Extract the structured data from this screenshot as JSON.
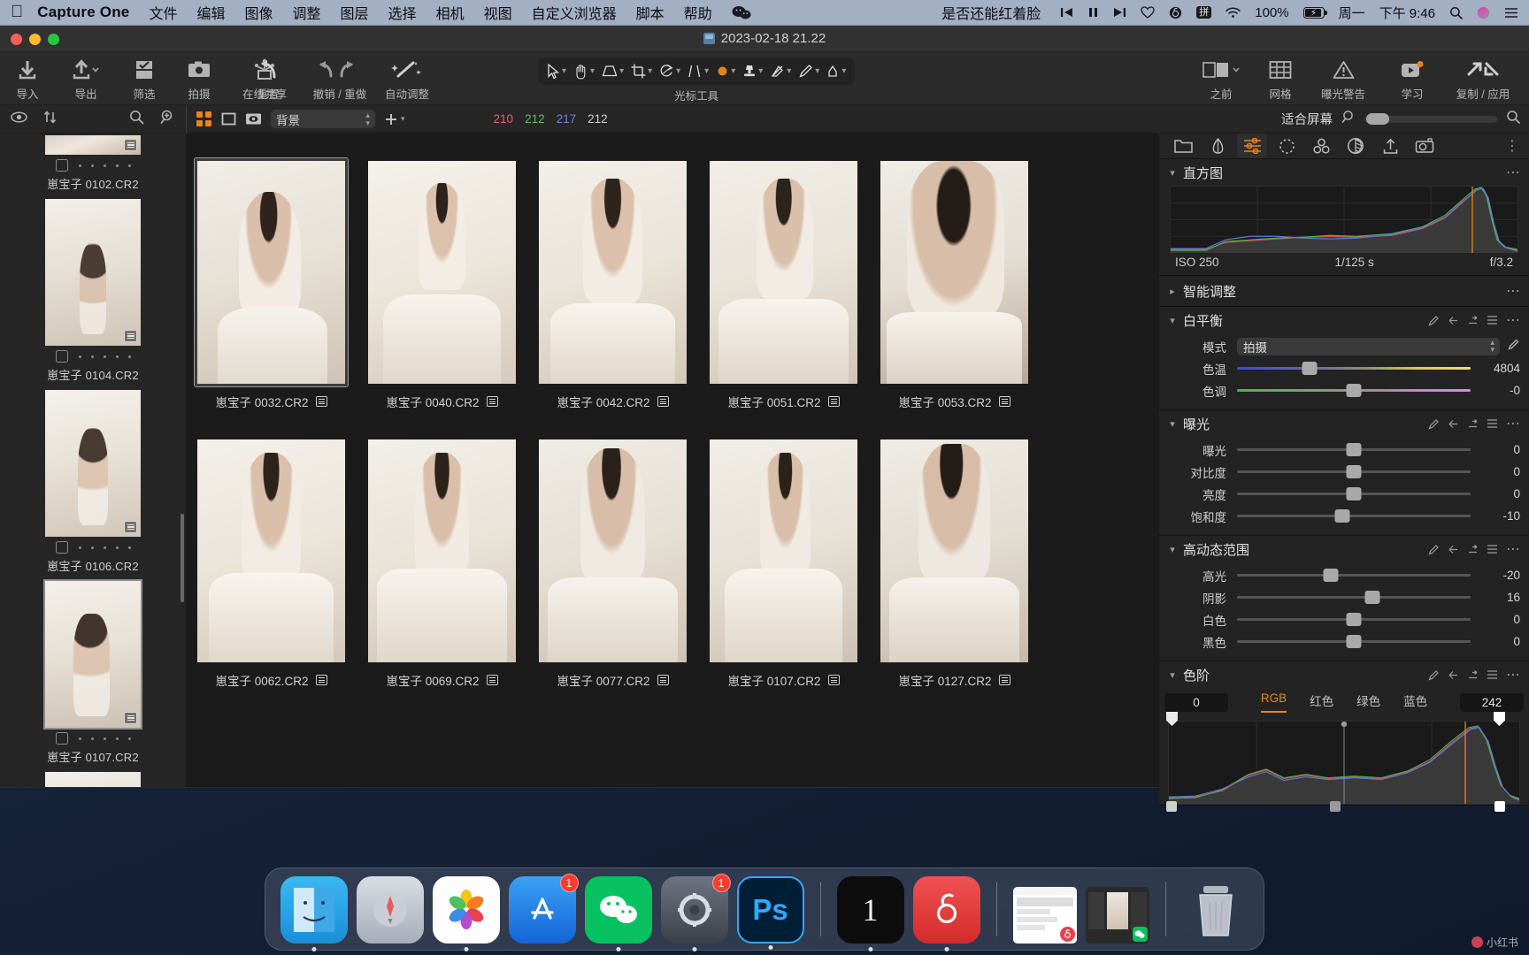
{
  "menubar": {
    "apple_icon": "apple-icon",
    "app_name": "Capture One",
    "items": [
      "文件",
      "编辑",
      "图像",
      "调整",
      "图层",
      "选择",
      "相机",
      "视图",
      "自定义浏览器",
      "脚本",
      "帮助"
    ],
    "wechat_icon": "wechat-icon",
    "now_playing": "是否还能红着脸",
    "controls": [
      "prev-track-icon",
      "pause-icon",
      "next-track-icon",
      "heart-icon",
      "netease-music-icon"
    ],
    "input_method": "拼",
    "wifi_icon": "wifi-icon",
    "battery_percent": "100%",
    "battery_icon": "battery-charging-icon",
    "day": "周一",
    "time": "下午 9:46",
    "spotlight_icon": "search-icon",
    "control_center_icon": "control-center-icon",
    "siri_icon": "siri-icon",
    "menu_list_icon": "menu-list-icon"
  },
  "window": {
    "document_title": "2023-02-18 21.22"
  },
  "toolbar": {
    "left_buttons": [
      {
        "name": "import",
        "label": "导入",
        "icon": "import-arrow-down-icon"
      },
      {
        "name": "export",
        "label": "导出",
        "icon": "export-arrow-up-icon"
      },
      {
        "name": "filter",
        "label": "筛选",
        "icon": "checkbox-filter-icon"
      },
      {
        "name": "capture",
        "label": "拍摄",
        "icon": "camera-icon"
      },
      {
        "name": "live-share",
        "label": "在线共享",
        "icon": "share-live-icon"
      }
    ],
    "history_buttons": [
      {
        "name": "reset",
        "label": "重置",
        "icon": "reset-arrow-icon"
      },
      {
        "name": "undo-redo",
        "label": "撤销 / 重做",
        "icon": "undo-redo-icon"
      }
    ],
    "auto_adjust": {
      "label": "自动调整",
      "icon": "magic-wand-icon"
    },
    "cursor_tools_label": "光标工具",
    "cursor_tools": [
      "pointer-select-icon",
      "pan-hand-icon",
      "keystone-icon",
      "crop-icon",
      "rotate-icon",
      "ratio-guide-icon",
      "color-spot-icon",
      "clone-stamp-icon",
      "eraser-icon",
      "draw-mask-icon",
      "heal-brush-icon"
    ],
    "right_buttons": [
      {
        "name": "before-after",
        "label": "之前",
        "icon": "before-after-icon"
      },
      {
        "name": "grid",
        "label": "网格",
        "icon": "grid-overlay-icon"
      },
      {
        "name": "exposure-warning",
        "label": "曝光警告",
        "icon": "warning-triangle-icon"
      },
      {
        "name": "learn",
        "label": "学习",
        "icon": "play-video-icon"
      },
      {
        "name": "copy-apply",
        "label": "复制 / 应用",
        "icon": "copy-apply-arrows-icon"
      }
    ]
  },
  "browser_bar": {
    "visibility_icon": "eye-icon",
    "sort_icon": "sort-updown-icon",
    "search_icon": "search-icon",
    "advanced_search_icon": "search-plus-icon",
    "view_modes": [
      "grid-view-icon",
      "list-view-icon",
      "detail-view-icon"
    ],
    "collection": "背景",
    "add_icon": "plus-icon",
    "readout": {
      "r": "210",
      "g": "212",
      "b": "217",
      "k": "212"
    },
    "readout_colors": {
      "r": "#e06363",
      "g": "#5fbf5f",
      "b": "#6b82e8",
      "k": "#cccccc"
    },
    "fit_label": "适合屏幕",
    "zoom_icon": "zoom-icon"
  },
  "filmstrip": {
    "items": [
      {
        "name": "崽宝子 0102.CR2",
        "selected": false,
        "partial": true
      },
      {
        "name": "崽宝子 0104.CR2",
        "selected": false
      },
      {
        "name": "崽宝子 0106.CR2",
        "selected": false
      },
      {
        "name": "崽宝子 0107.CR2",
        "selected": true
      }
    ]
  },
  "browser_grid": {
    "rows": [
      [
        {
          "name": "崽宝子 0032.CR2",
          "selected": true
        },
        {
          "name": "崽宝子 0040.CR2",
          "selected": false
        },
        {
          "name": "崽宝子 0042.CR2",
          "selected": false
        },
        {
          "name": "崽宝子 0051.CR2",
          "selected": false
        },
        {
          "name": "崽宝子 0053.CR2",
          "selected": false
        }
      ],
      [
        {
          "name": "崽宝子 0062.CR2",
          "selected": false
        },
        {
          "name": "崽宝子 0069.CR2",
          "selected": false
        },
        {
          "name": "崽宝子 0077.CR2",
          "selected": false
        },
        {
          "name": "崽宝子 0107.CR2",
          "selected": false
        },
        {
          "name": "崽宝子 0127.CR2",
          "selected": false
        }
      ]
    ]
  },
  "tools": {
    "tabs": [
      {
        "name": "library",
        "icon": "folder-icon",
        "active": false
      },
      {
        "name": "capture",
        "icon": "tether-icon",
        "active": false
      },
      {
        "name": "adjust",
        "icon": "sliders-icon",
        "active": true
      },
      {
        "name": "details",
        "icon": "dotted-circle-icon",
        "active": false
      },
      {
        "name": "color",
        "icon": "color-circles-icon",
        "active": false
      },
      {
        "name": "styles",
        "icon": "styles-disc-icon",
        "active": false
      },
      {
        "name": "export",
        "icon": "export-arrow-icon",
        "active": false
      },
      {
        "name": "metadata",
        "icon": "camera-meta-icon",
        "active": false
      }
    ],
    "more_icon": "more-vertical-icon",
    "histogram": {
      "title": "直方图",
      "expanded": true,
      "iso": "ISO 250",
      "shutter": "1/125 s",
      "aperture": "f/3.2"
    },
    "smart_adjust": {
      "title": "智能调整",
      "expanded": false
    },
    "white_balance": {
      "title": "白平衡",
      "expanded": true,
      "mode_label": "模式",
      "mode_value": "拍摄",
      "sliders": [
        {
          "label": "色温",
          "value": "4804",
          "pos": 31
        },
        {
          "label": "色调",
          "value": "-0",
          "pos": 50
        }
      ]
    },
    "exposure": {
      "title": "曝光",
      "expanded": true,
      "sliders": [
        {
          "label": "曝光",
          "value": "0",
          "pos": 50
        },
        {
          "label": "对比度",
          "value": "0",
          "pos": 50
        },
        {
          "label": "亮度",
          "value": "0",
          "pos": 50
        },
        {
          "label": "饱和度",
          "value": "-10",
          "pos": 45
        }
      ]
    },
    "hdr": {
      "title": "高动态范围",
      "expanded": true,
      "sliders": [
        {
          "label": "高光",
          "value": "-20",
          "pos": 40
        },
        {
          "label": "阴影",
          "value": "16",
          "pos": 58
        },
        {
          "label": "白色",
          "value": "0",
          "pos": 50
        },
        {
          "label": "黑色",
          "value": "0",
          "pos": 50
        }
      ]
    },
    "levels": {
      "title": "色阶",
      "expanded": true,
      "black_point": "0",
      "white_point": "242",
      "channels": [
        {
          "label": "RGB",
          "active": true
        },
        {
          "label": "红色",
          "active": false
        },
        {
          "label": "绿色",
          "active": false
        },
        {
          "label": "蓝色",
          "active": false
        }
      ]
    },
    "panel_icons": [
      "eyedropper-icon",
      "reset-panel-icon",
      "copy-panel-icon",
      "presets-icon",
      "panel-menu-icon"
    ]
  },
  "dock": {
    "items": [
      {
        "name": "finder",
        "label": "Finder",
        "badge": null
      },
      {
        "name": "launchpad",
        "label": "Launchpad",
        "badge": null
      },
      {
        "name": "photos",
        "label": "Photos",
        "badge": null
      },
      {
        "name": "app-store",
        "label": "App Store",
        "badge": "1"
      },
      {
        "name": "wechat",
        "label": "WeChat",
        "badge": null
      },
      {
        "name": "system-settings",
        "label": "System Settings",
        "badge": "1"
      },
      {
        "name": "photoshop",
        "label": "Photoshop",
        "badge": null
      },
      {
        "name": "capture-one",
        "label": "Capture One",
        "badge": null
      },
      {
        "name": "netease-music",
        "label": "NetEase Music",
        "badge": null
      },
      {
        "name": "window-thumb-1",
        "label": "Minimized Window",
        "badge": null
      },
      {
        "name": "window-thumb-2",
        "label": "Minimized Window",
        "badge": null
      },
      {
        "name": "trash",
        "label": "Trash",
        "badge": null
      }
    ],
    "watermark": "小红书"
  },
  "colors": {
    "accent": "#e8841a",
    "panel_bg": "#232323",
    "window_bg": "#2c2c2c",
    "browser_bg": "#1b1b1b"
  }
}
